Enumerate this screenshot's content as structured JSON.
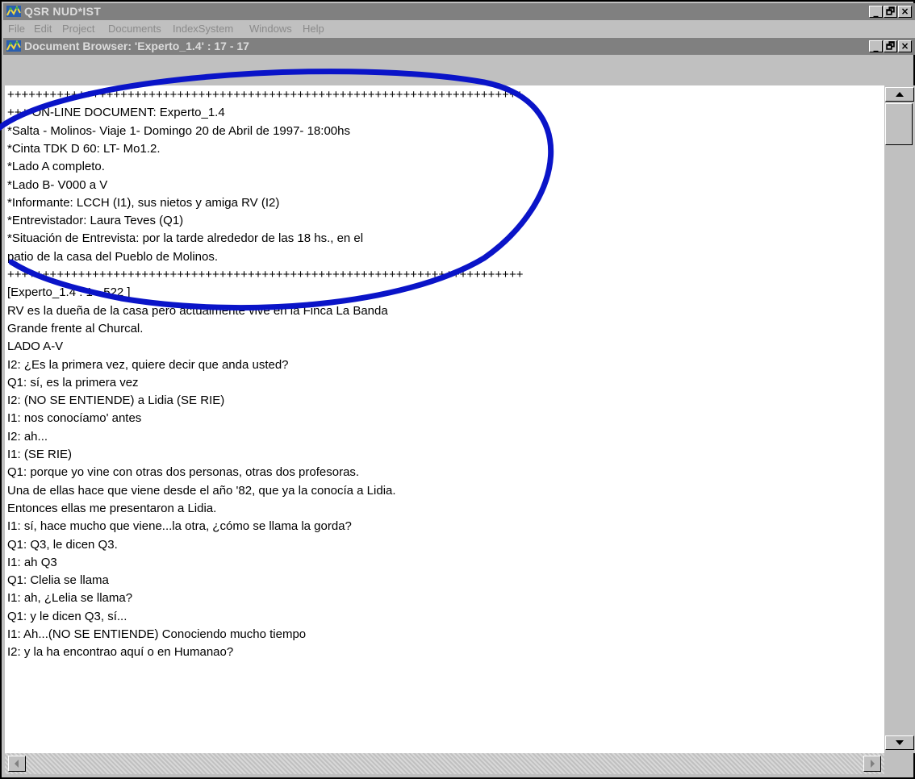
{
  "app": {
    "title": "QSR NUD*IST",
    "controls": [
      "_",
      "🗗",
      "×"
    ]
  },
  "menu": {
    "items": [
      "File",
      "Edit",
      "Project",
      "Documents",
      "IndexSystem",
      "Windows",
      "Help"
    ]
  },
  "document_window": {
    "title": "Document Browser: 'Experto_1.4' : 17 - 17"
  },
  "document": {
    "lines": [
      "+++++++++++++++++++++++++++++++++++++++++++++++++++++++++++++++++++++++++",
      "+++ ON-LINE DOCUMENT: Experto_1.4",
      "*Salta - Molinos- Viaje 1- Domingo 20 de Abril de 1997- 18:00hs",
      "*Cinta TDK D 60: LT- Mo1.2.",
      "*Lado A completo.",
      "*Lado B- V000 a V",
      "*Informante: LCCH (I1), sus nietos y amiga RV (I2)",
      "*Entrevistador: Laura Teves (Q1)",
      "*Situación de Entrevista: por la tarde alrededor de las 18 hs., en el",
      "patio de la casa del Pueblo de Molinos.",
      "+++++++++++++++++++++++++++++++++++++++++++++++++++++++++++++++++++++++++",
      "[Experto_1.4 : 1 - 522 ]",
      "RV es la dueña de la casa pero actualmente vive en la Finca La Banda",
      "Grande frente al Churcal.",
      "LADO A-V",
      "I2: ¿Es la primera vez, quiere decir que anda usted?",
      "Q1: sí, es la primera vez",
      "I2: (NO SE ENTIENDE) a Lidia (SE RIE)",
      "I1: nos conocíamo' antes",
      "I2: ah...",
      "I1: (SE RIE)",
      "Q1: porque yo vine con otras dos personas, otras dos profesoras.",
      "Una de ellas hace que viene desde el año '82, que ya la conocía a Lidia.",
      "Entonces ellas me presentaron a Lidia.",
      "I1: sí, hace mucho que viene...la otra, ¿cómo se llama la gorda?",
      "Q1: Q3, le dicen Q3.",
      "I1: ah Q3",
      "Q1: Clelia se llama",
      "I1: ah, ¿Lelia se llama?",
      "Q1: y le dicen Q3, sí...",
      "I1: Ah...(NO SE ENTIENDE) Conociendo mucho tiempo",
      "I2: y la ha encontrao aquí o en Humanao?"
    ]
  },
  "colors": {
    "titlebar": "#808080",
    "highlight_ellipse": "#0a14c8"
  }
}
